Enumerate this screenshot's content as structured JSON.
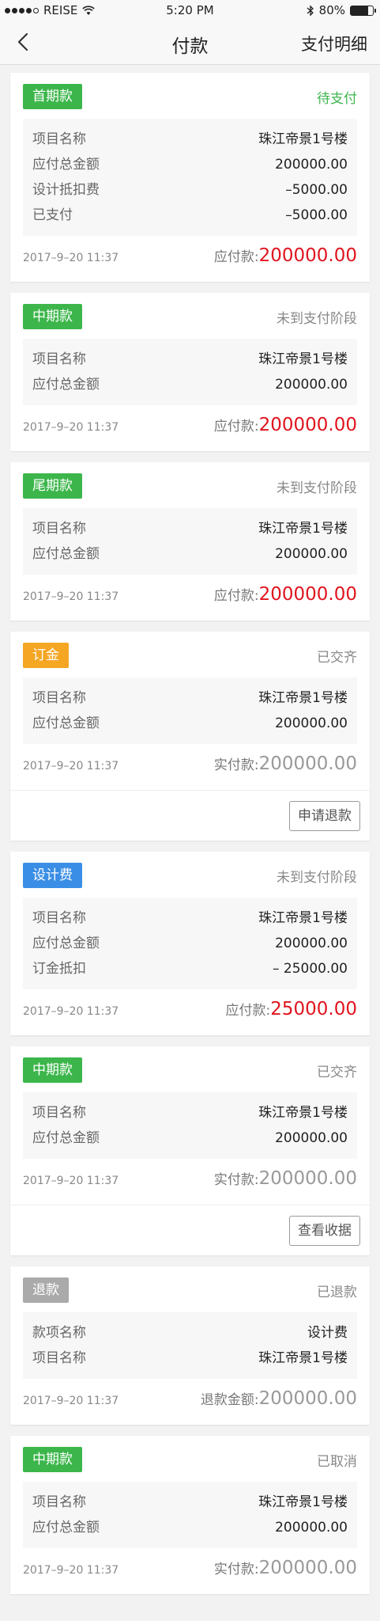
{
  "status_bar": {
    "carrier": "REISE",
    "time": "5:20 PM",
    "battery": "80%",
    "battery_level": 0.8
  },
  "nav": {
    "title": "付款",
    "detail_link": "支付明细"
  },
  "colors": {
    "green": "#3cb64b",
    "orange": "#f5a623",
    "blue": "#3a8ee6",
    "gray": "#aaaaaa",
    "red": "#e0141e",
    "green_text": "#3cb64b"
  },
  "cards": [
    {
      "tag": "首期款",
      "tag_color": "#3cb64b",
      "status": "待支付",
      "status_color": "#3cb64b",
      "rows": [
        {
          "k": "项目名称",
          "v": "珠江帝景1号楼"
        },
        {
          "k": "应付总金额",
          "v": "200000.00"
        },
        {
          "k": "设计抵扣费",
          "v": "–5000.00"
        },
        {
          "k": "已支付",
          "v": "–5000.00"
        }
      ],
      "date": "2017–9–20 11:37",
      "amount_label": "应付款:",
      "amount": "200000.00",
      "amount_color": "#e0141e",
      "button": ""
    },
    {
      "tag": "中期款",
      "tag_color": "#3cb64b",
      "status": "未到支付阶段",
      "status_color": "#888888",
      "rows": [
        {
          "k": "项目名称",
          "v": "珠江帝景1号楼"
        },
        {
          "k": "应付总金额",
          "v": "200000.00"
        }
      ],
      "date": "2017–9–20 11:37",
      "amount_label": "应付款:",
      "amount": "200000.00",
      "amount_color": "#e0141e",
      "button": ""
    },
    {
      "tag": "尾期款",
      "tag_color": "#3cb64b",
      "status": "未到支付阶段",
      "status_color": "#888888",
      "rows": [
        {
          "k": "项目名称",
          "v": "珠江帝景1号楼"
        },
        {
          "k": "应付总金额",
          "v": "200000.00"
        }
      ],
      "date": "2017–9–20 11:37",
      "amount_label": "应付款:",
      "amount": "200000.00",
      "amount_color": "#e0141e",
      "button": ""
    },
    {
      "tag": "订金",
      "tag_color": "#f5a623",
      "status": "已交齐",
      "status_color": "#888888",
      "rows": [
        {
          "k": "项目名称",
          "v": "珠江帝景1号楼"
        },
        {
          "k": "应付总金额",
          "v": "200000.00"
        }
      ],
      "date": "2017–9–20 11:37",
      "amount_label": "实付款:",
      "amount": "200000.00",
      "amount_color": "#999999",
      "button": "申请退款"
    },
    {
      "tag": "设计费",
      "tag_color": "#3a8ee6",
      "status": "未到支付阶段",
      "status_color": "#888888",
      "rows": [
        {
          "k": "项目名称",
          "v": "珠江帝景1号楼"
        },
        {
          "k": "应付总金额",
          "v": "200000.00"
        },
        {
          "k": "订金抵扣",
          "v": "– 25000.00"
        }
      ],
      "date": "2017–9–20 11:37",
      "amount_label": "应付款:",
      "amount": "25000.00",
      "amount_color": "#e0141e",
      "button": ""
    },
    {
      "tag": "中期款",
      "tag_color": "#3cb64b",
      "status": "已交齐",
      "status_color": "#888888",
      "rows": [
        {
          "k": "项目名称",
          "v": "珠江帝景1号楼"
        },
        {
          "k": "应付总金额",
          "v": "200000.00"
        }
      ],
      "date": "2017–9–20 11:37",
      "amount_label": "实付款:",
      "amount": "200000.00",
      "amount_color": "#999999",
      "button": "查看收据"
    },
    {
      "tag": "退款",
      "tag_color": "#aaaaaa",
      "status": "已退款",
      "status_color": "#888888",
      "rows": [
        {
          "k": "款项名称",
          "v": "设计费"
        },
        {
          "k": "项目名称",
          "v": "珠江帝景1号楼"
        }
      ],
      "date": "2017–9–20 11:37",
      "amount_label": "退款金额:",
      "amount": "200000.00",
      "amount_color": "#999999",
      "button": ""
    },
    {
      "tag": "中期款",
      "tag_color": "#3cb64b",
      "status": "已取消",
      "status_color": "#888888",
      "rows": [
        {
          "k": "项目名称",
          "v": "珠江帝景1号楼"
        },
        {
          "k": "应付总金额",
          "v": "200000.00"
        }
      ],
      "date": "2017–9–20 11:37",
      "amount_label": "实付款:",
      "amount": "200000.00",
      "amount_color": "#999999",
      "button": ""
    }
  ]
}
